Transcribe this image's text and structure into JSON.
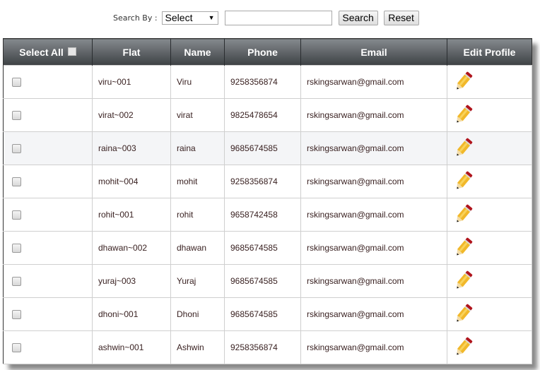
{
  "search": {
    "label": "Search By :",
    "select_value": "Select",
    "input_value": "",
    "search_button": "Search",
    "reset_button": "Reset"
  },
  "table": {
    "headers": [
      "Select All",
      "Flat",
      "Name",
      "Phone",
      "Email",
      "Edit Profile"
    ],
    "rows": [
      {
        "flat": "viru~001",
        "name": "Viru",
        "phone": "9258356874",
        "email": "rskingsarwan@gmail.com"
      },
      {
        "flat": "virat~002",
        "name": "virat",
        "phone": "9825478654",
        "email": "rskingsarwan@gmail.com"
      },
      {
        "flat": "raina~003",
        "name": "raina",
        "phone": "9685674585",
        "email": "rskingsarwan@gmail.com"
      },
      {
        "flat": "mohit~004",
        "name": "mohit",
        "phone": "9258356874",
        "email": "rskingsarwan@gmail.com"
      },
      {
        "flat": "rohit~001",
        "name": "rohit",
        "phone": "9658742458",
        "email": "rskingsarwan@gmail.com"
      },
      {
        "flat": "dhawan~002",
        "name": "dhawan",
        "phone": "9685674585",
        "email": "rskingsarwan@gmail.com"
      },
      {
        "flat": "yuraj~003",
        "name": "Yuraj",
        "phone": "9685674585",
        "email": "rskingsarwan@gmail.com"
      },
      {
        "flat": "dhoni~001",
        "name": "Dhoni",
        "phone": "9685674585",
        "email": "rskingsarwan@gmail.com"
      },
      {
        "flat": "ashwin~001",
        "name": "Ashwin",
        "phone": "9258356874",
        "email": "rskingsarwan@gmail.com"
      }
    ],
    "hovered_row_index": 2,
    "edit_icon": "pencil-icon"
  },
  "colors": {
    "header_top": "#858a8e",
    "header_bottom": "#3d4144",
    "hover_row": "#f4f5f7"
  }
}
